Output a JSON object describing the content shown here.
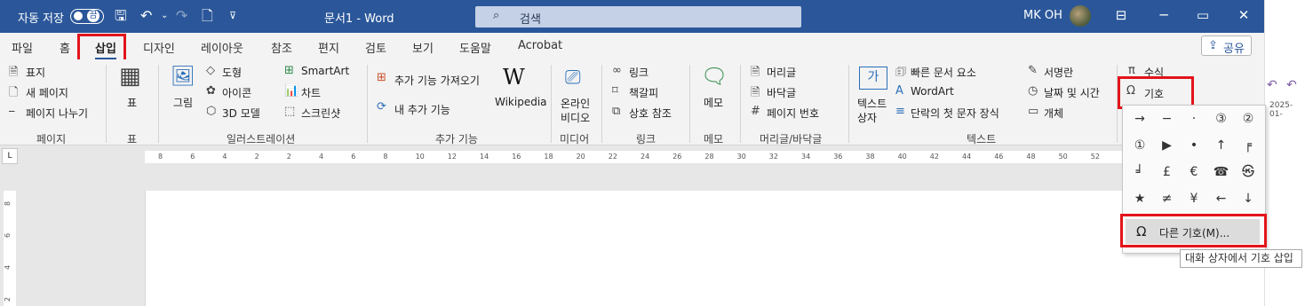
{
  "titlebar": {
    "autosave": "자동 저장",
    "autosave_state": "끔",
    "doc_title": "문서1  -  Word",
    "search_placeholder": "검색",
    "user": "MK OH",
    "minimize": "─",
    "restore": "▭",
    "close": "✕"
  },
  "tabs": [
    "파일",
    "홈",
    "삽입",
    "디자인",
    "레이아웃",
    "참조",
    "편지",
    "검토",
    "보기",
    "도움말",
    "Acrobat"
  ],
  "share_label": "공유",
  "ribbon": {
    "pages": {
      "cover": "표지",
      "blank": "새 페이지",
      "break": "페이지 나누기",
      "group": "페이지"
    },
    "table": {
      "label": "표",
      "group": "표"
    },
    "illus": {
      "pictures": "그림",
      "shapes": "도형",
      "icons": "아이콘",
      "models": "3D 모델",
      "smartart": "SmartArt",
      "chart": "차트",
      "screenshot": "스크린샷",
      "group": "일러스트레이션"
    },
    "addins": {
      "get": "추가 기능 가져오기",
      "mine": "내 추가 기능",
      "wikipedia": "Wikipedia",
      "group": "추가 기능"
    },
    "media": {
      "video1": "온라인",
      "video2": "비디오",
      "group": "미디어"
    },
    "links": {
      "link": "링크",
      "bookmark": "책갈피",
      "xref": "상호 참조",
      "group": "링크"
    },
    "comments": {
      "comment": "메모",
      "group": "메모"
    },
    "hf": {
      "header": "머리글",
      "footer": "바닥글",
      "pagenum": "페이지 번호",
      "group": "머리글/바닥글"
    },
    "text": {
      "textbox1": "텍스트",
      "textbox2": "상자",
      "quickparts": "빠른 문서 요소",
      "wordart": "WordArt",
      "dropcap": "단락의 첫 문자 장식",
      "signature": "서명란",
      "datetime": "날짜 및 시간",
      "object": "개체",
      "group": "텍스트"
    },
    "symbols": {
      "equation": "수식",
      "symbol": "기호"
    }
  },
  "ruler_numbers": [
    "8",
    "6",
    "4",
    "2",
    "2",
    "4",
    "6",
    "8",
    "10",
    "12",
    "14",
    "16",
    "18",
    "20",
    "22",
    "24",
    "26",
    "28",
    "30",
    "32",
    "34",
    "36",
    "38",
    "40",
    "42",
    "44",
    "46",
    "48",
    "50",
    "52"
  ],
  "vruler_numbers": [
    "8",
    "6",
    "4",
    "2"
  ],
  "symbols_grid": [
    [
      "→",
      "−",
      "·",
      "③",
      "②"
    ],
    [
      "①",
      "▶",
      "•",
      "↑",
      "╒"
    ],
    [
      "╛",
      "£",
      "€",
      "☎",
      "㉿"
    ],
    [
      "★",
      "≠",
      "¥",
      "←",
      "↓"
    ]
  ],
  "more_symbols": "다른 기호(M)...",
  "tooltip": "대화 상자에서 기호 삽입",
  "side_date": "2025-01-",
  "colors": {
    "word_blue": "#2b579a",
    "highlight_red": "#e3141b"
  }
}
